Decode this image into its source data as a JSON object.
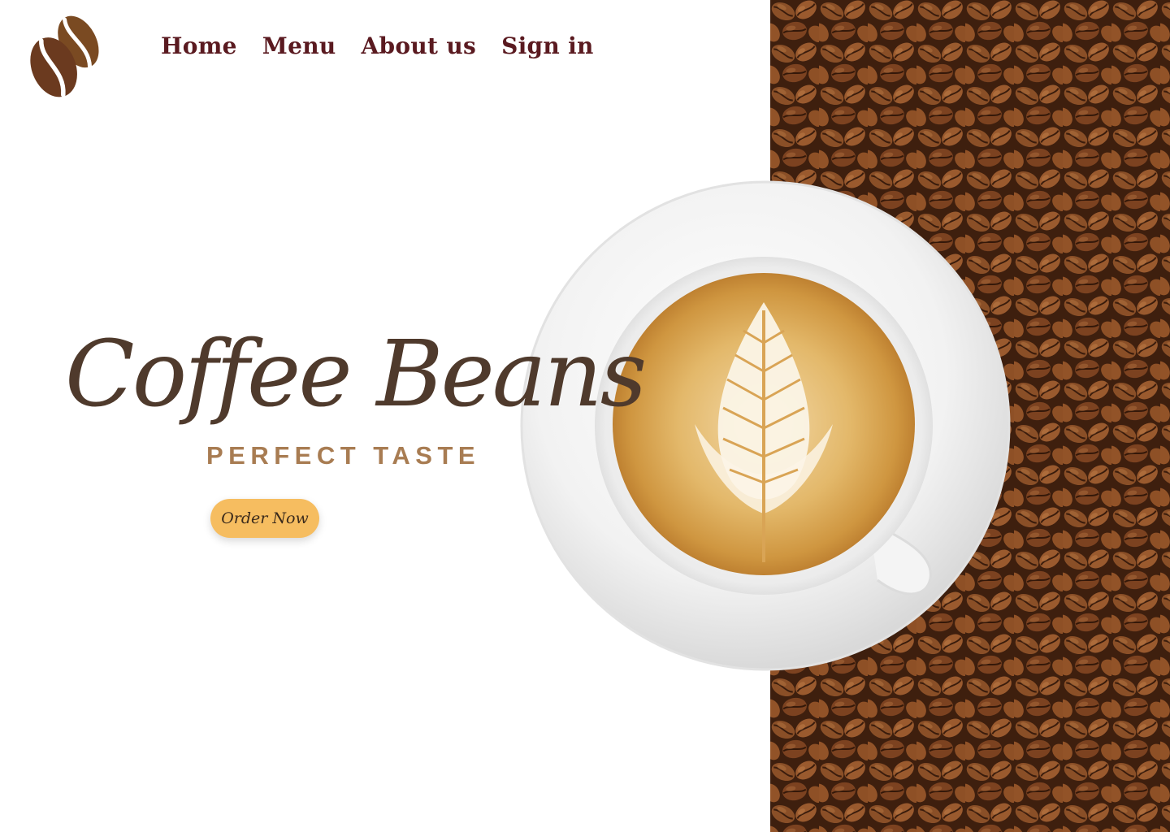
{
  "brand": {
    "logo_icon": "coffee-bean-icon"
  },
  "nav": {
    "items": [
      {
        "label": "Home"
      },
      {
        "label": "Menu"
      },
      {
        "label": "About us"
      },
      {
        "label": "Sign in"
      }
    ]
  },
  "hero": {
    "title": "Coffee Beans",
    "subtitle": "PERFECT TASTE",
    "cta_label": "Order Now",
    "image_icon": "latte-cup-icon",
    "background_icon": "coffee-beans-texture"
  },
  "colors": {
    "nav_text": "#5a1a20",
    "title": "#4f3a2c",
    "subtitle": "#a87c52",
    "button": "#f6bd60",
    "bean": "#6b3a1f"
  }
}
